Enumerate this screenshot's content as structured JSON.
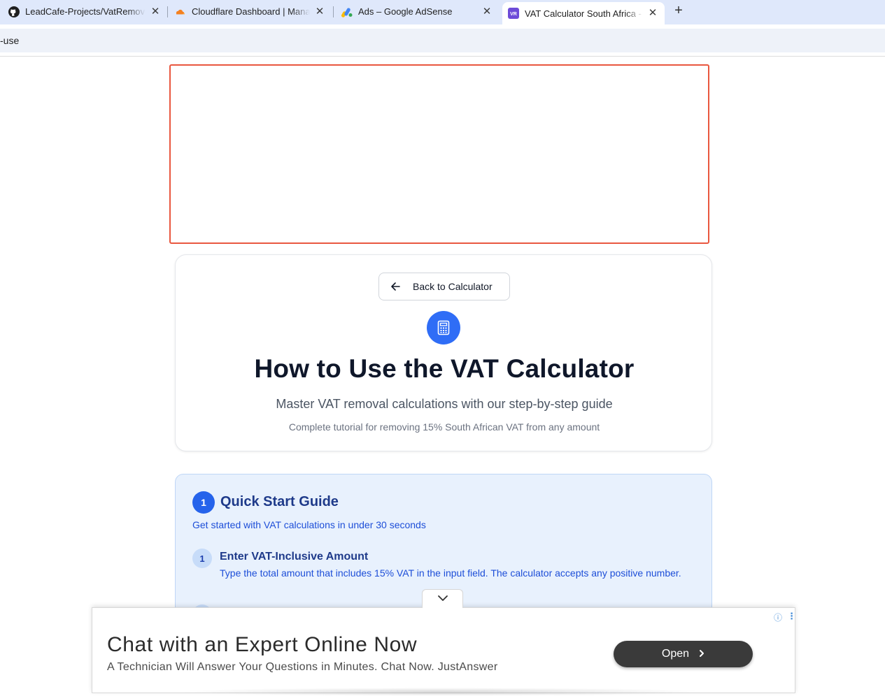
{
  "browser": {
    "tabs": [
      {
        "title": "LeadCafe-Projects/VatRemover",
        "icon": "github-icon"
      },
      {
        "title": "Cloudflare Dashboard | Manage",
        "icon": "cloudflare-icon"
      },
      {
        "title": "Ads – Google AdSense",
        "icon": "adsense-icon"
      },
      {
        "title": "VAT Calculator South Africa -",
        "icon": "vr-icon",
        "active": true
      }
    ],
    "close_glyph": "✕",
    "new_tab_glyph": "+",
    "bookmark_text": "-use"
  },
  "hero": {
    "back_label": "Back to Calculator",
    "title": "How to Use the VAT Calculator",
    "subtitle": "Master VAT removal calculations with our step-by-step guide",
    "tagline": "Complete tutorial for removing 15% South African VAT from any amount"
  },
  "quick_start": {
    "number": "1",
    "title": "Quick Start Guide",
    "description": "Get started with VAT calculations in under 30 seconds",
    "steps": [
      {
        "number": "1",
        "title": "Enter VAT-Inclusive Amount",
        "text": "Type the total amount that includes 15% VAT in the input field. The calculator accepts any positive number."
      }
    ]
  },
  "anchor_ad": {
    "headline": "Chat with an Expert Online Now",
    "body": "A Technician Will Answer Your Questions in Minutes. Chat Now. JustAnswer",
    "button_label": "Open",
    "info_glyph": "ⓘ",
    "menu_glyph": "⋮"
  },
  "colors": {
    "accent": "#2563eb",
    "ad_border": "#e9573f",
    "quick_bg": "#e8f1fd"
  }
}
